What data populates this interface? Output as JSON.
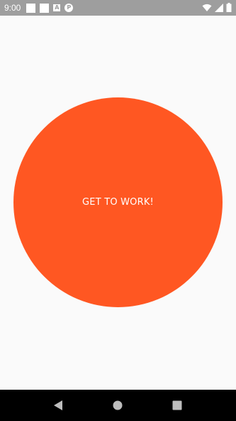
{
  "status_bar": {
    "time": "9:00",
    "notification_icons": [
      "square-icon",
      "square-icon",
      "a-icon",
      "p-icon"
    ],
    "notif_a_glyph": "A",
    "notif_p_glyph": "P"
  },
  "main": {
    "button_label": "GET TO WORK!",
    "button_color": "#ff5722"
  },
  "nav_bar": {
    "buttons": [
      "back-icon",
      "home-icon",
      "recents-icon"
    ]
  }
}
